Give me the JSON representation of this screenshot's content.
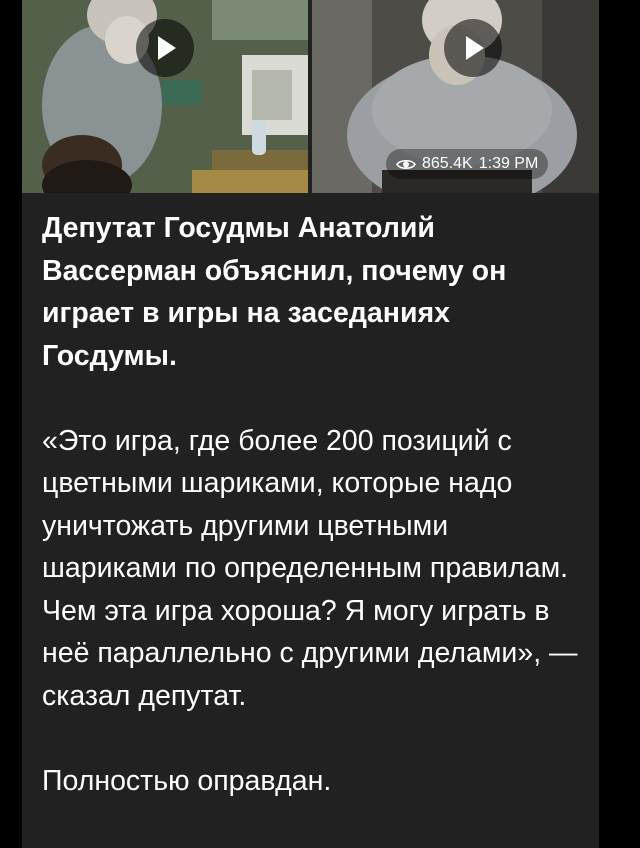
{
  "post": {
    "videos": [
      {
        "name": "left-video",
        "play_icon": "play-icon"
      },
      {
        "name": "right-video",
        "play_icon": "play-icon"
      }
    ],
    "meta": {
      "views": "865.4K",
      "time": "1:39 PM",
      "views_icon": "eye-icon"
    },
    "headline": "Депутат Госудмы Анатолий Вассерман объяснил, почему он играет в игры на заседаниях Госдумы.",
    "quote": "«Это игра, где более 200 позиций с цветными шариками, которые надо уничтожать другими цветными шариками по определенным правилам. Чем эта игра хороша? Я могу играть в неё параллельно с другими делами», — сказал депутат.",
    "closing": "Полностью оправдан.",
    "colors": {
      "background": "#000000",
      "bubble": "#212121",
      "text": "#ffffff"
    }
  }
}
